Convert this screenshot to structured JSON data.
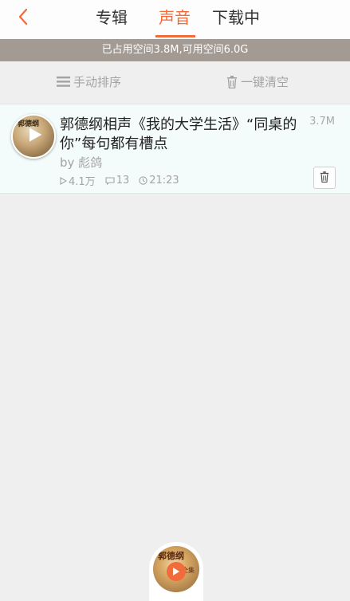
{
  "header": {
    "tabs": [
      {
        "label": "专辑",
        "active": false
      },
      {
        "label": "声音",
        "active": true
      },
      {
        "label": "下载中",
        "active": false
      }
    ]
  },
  "storage": {
    "text": "已占用空间3.8M,可用空间6.0G"
  },
  "actions": {
    "sort_label": "手动排序",
    "clear_label": "一键清空"
  },
  "track": {
    "title": "郭德纲相声《我的大学生活》“同桌的你”每句都有槽点",
    "author": "by 彪鸽",
    "size": "3.7M",
    "plays": "4.1万",
    "comments": "13",
    "duration": "21:23",
    "cover_caption": "郭德纲"
  },
  "player": {
    "caption": "郭德纲",
    "caption2": "全集"
  },
  "colors": {
    "accent": "#f26b3a",
    "storage_bar": "#a39b93",
    "item_bg": "#f3fcfa"
  },
  "icons": {
    "back": "chevron-left-icon",
    "sort": "list-icon",
    "clear": "trash-icon",
    "plays": "play-triangle-icon",
    "comments": "comment-icon",
    "duration": "clock-icon",
    "delete": "trash-icon",
    "play": "play-icon"
  }
}
